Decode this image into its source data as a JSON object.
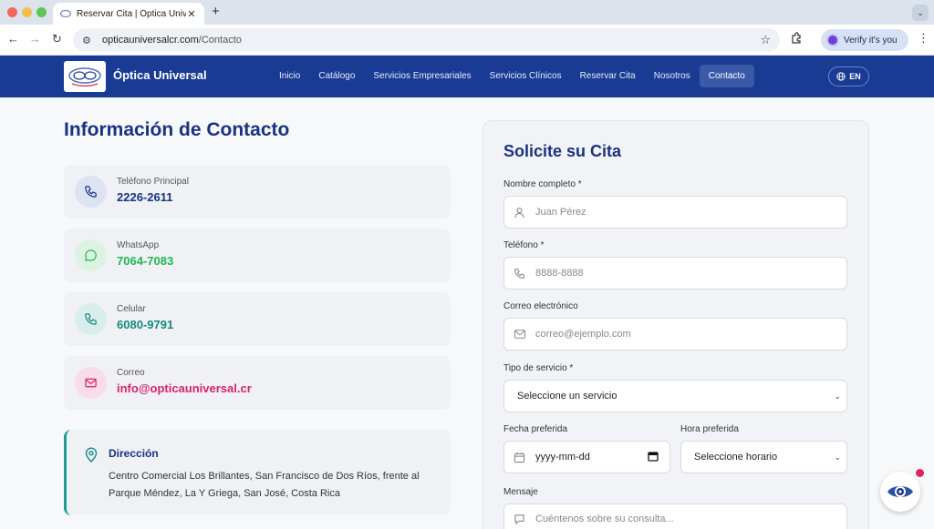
{
  "browser": {
    "tab_title": "Reservar Cita | Óptica Univers",
    "url_host": "opticauniversalcr.com",
    "url_path": "/Contacto",
    "verify_label": "Verify it's you"
  },
  "site": {
    "brand": "Óptica Universal",
    "nav": [
      "Inicio",
      "Catálogo",
      "Servicios Empresariales",
      "Servicios Clínicos",
      "Reservar Cita",
      "Nosotros",
      "Contacto"
    ],
    "active_nav": "Contacto",
    "lang": "EN"
  },
  "contact": {
    "title": "Información de Contacto",
    "items": [
      {
        "label": "Teléfono Principal",
        "value": "2226-2611",
        "icon": "phone-icon",
        "color": "#1a3380",
        "bg": "#dde3f3"
      },
      {
        "label": "WhatsApp",
        "value": "7064-7083",
        "icon": "whatsapp-icon",
        "color": "#1fb853",
        "bg": "#dcf3e4"
      },
      {
        "label": "Celular",
        "value": "6080-9791",
        "icon": "phone-icon",
        "color": "#158a80",
        "bg": "#d9eeeb"
      },
      {
        "label": "Correo",
        "value": "info@opticauniversal.cr",
        "icon": "mail-icon",
        "color": "#d6246e",
        "bg": "#f8dde8"
      }
    ],
    "address": {
      "title": "Dirección",
      "text": "Centro Comercial Los Brillantes, San Francisco de Dos Ríos, frente al Parque Méndez, La Y Griega, San José, Costa Rica"
    }
  },
  "form": {
    "title": "Solicite su Cita",
    "name_label": "Nombre completo *",
    "name_placeholder": "Juan Pérez",
    "phone_label": "Teléfono *",
    "phone_placeholder": "8888-8888",
    "email_label": "Correo electrónico",
    "email_placeholder": "correo@ejemplo.com",
    "service_label": "Tipo de servicio *",
    "service_value": "Seleccione un servicio",
    "date_label": "Fecha preferida",
    "date_value": "yyyy-mm-dd",
    "time_label": "Hora preferida",
    "time_value": "Seleccione horario",
    "message_label": "Mensaje",
    "message_placeholder": "Cuéntenos sobre su consulta..."
  }
}
